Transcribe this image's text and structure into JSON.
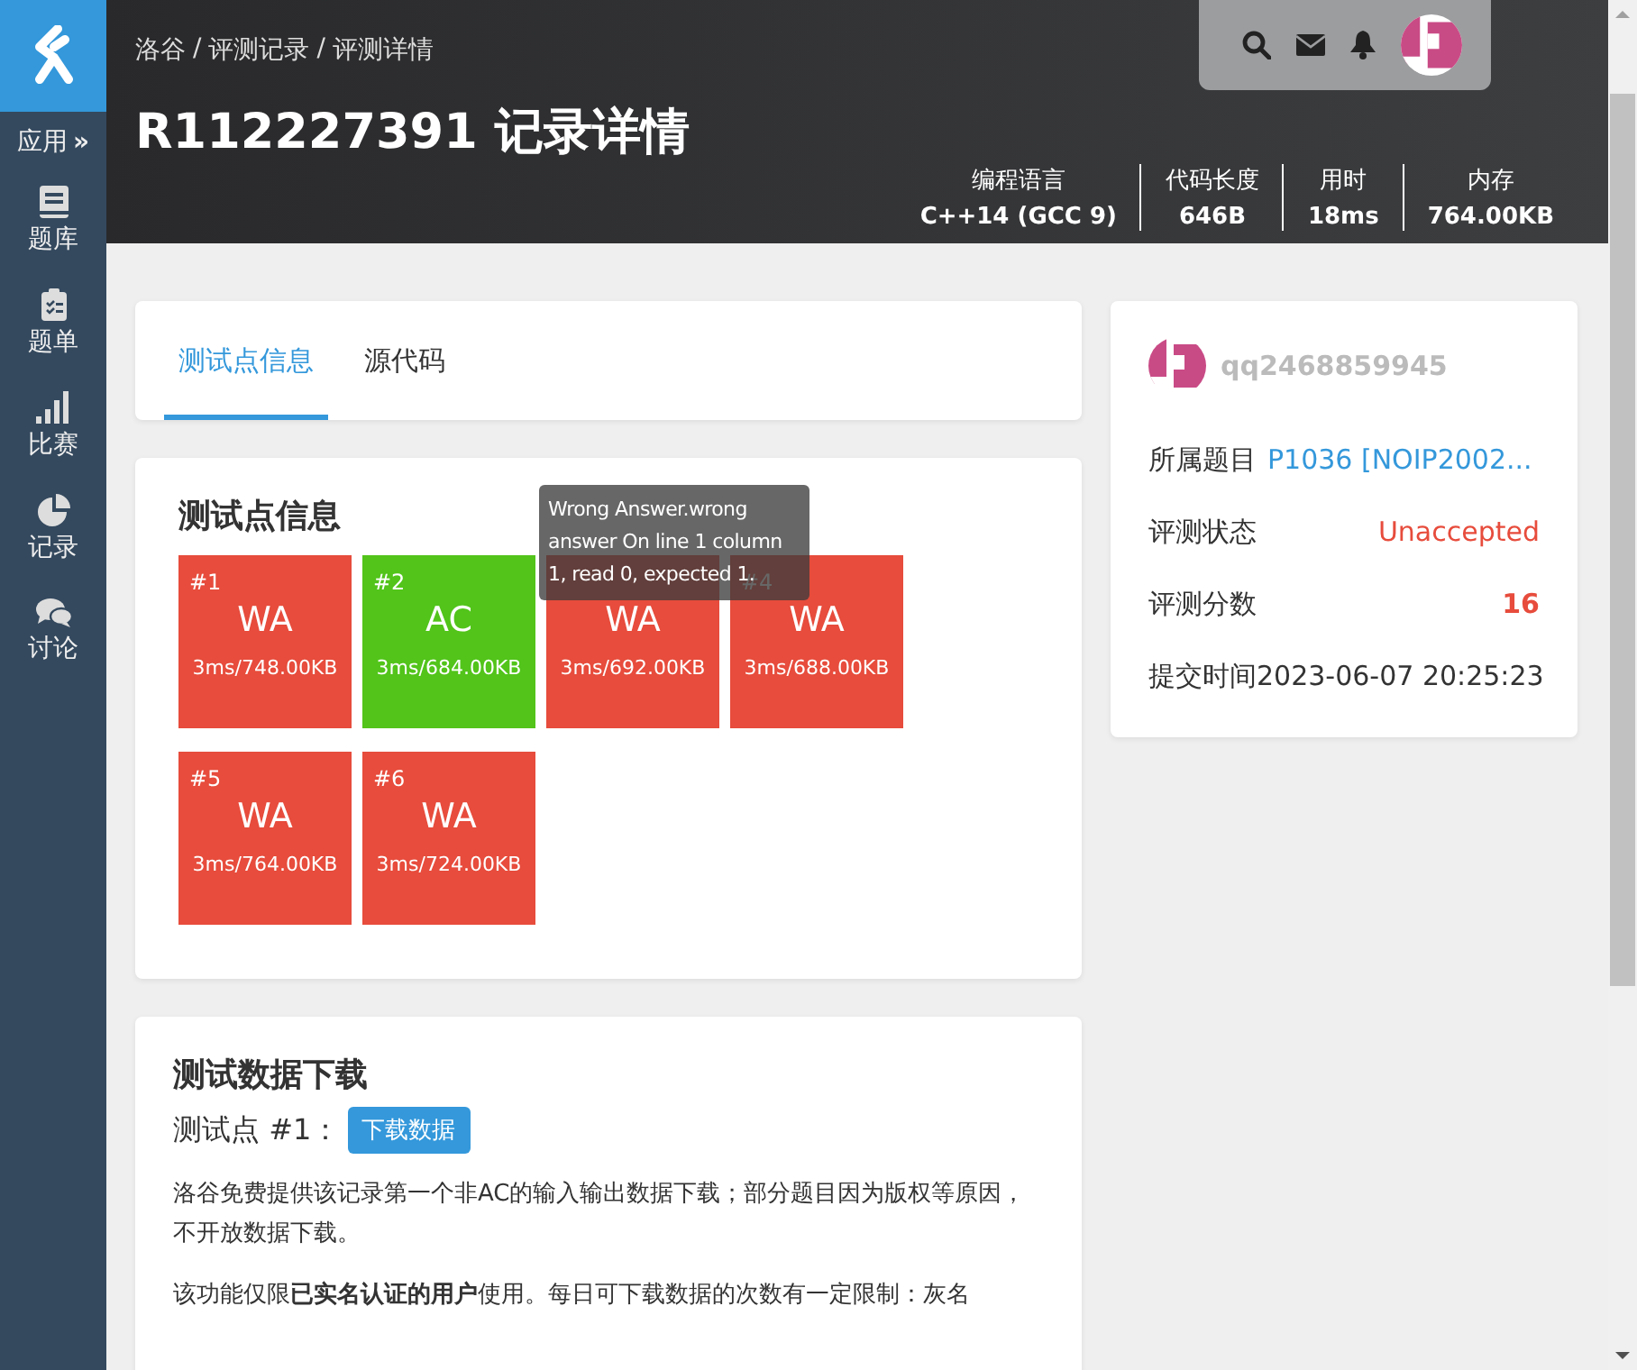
{
  "sidebar": {
    "apps_label": "应用",
    "apps_arrow": "»",
    "items": [
      {
        "kind": "book",
        "label": "题库"
      },
      {
        "kind": "clipboard",
        "label": "题单"
      },
      {
        "kind": "bars",
        "label": "比赛"
      },
      {
        "kind": "pie",
        "label": "记录"
      },
      {
        "kind": "chat",
        "label": "讨论"
      }
    ]
  },
  "header": {
    "breadcrumb": [
      "洛谷",
      "评测记录",
      "评测详情"
    ],
    "separator": "/",
    "title": "R112227391 记录详情",
    "stats": [
      {
        "label": "编程语言",
        "value": "C++14 (GCC 9)"
      },
      {
        "label": "代码长度",
        "value": "646B"
      },
      {
        "label": "用时",
        "value": "18ms"
      },
      {
        "label": "内存",
        "value": "764.00KB"
      }
    ]
  },
  "tabs": [
    {
      "label": "测试点信息",
      "selected": true
    },
    {
      "label": "源代码",
      "selected": false
    }
  ],
  "testcases": {
    "title": "测试点信息",
    "cases": [
      {
        "label": "#1",
        "status": "WA",
        "detail": "3ms/748.00KB"
      },
      {
        "label": "#2",
        "status": "AC",
        "detail": "3ms/684.00KB"
      },
      {
        "status": "WA",
        "detail": "3ms/692.00KB"
      },
      {
        "label": "#4",
        "status": "WA",
        "detail": "3ms/688.00KB"
      },
      {
        "label": "#5",
        "status": "WA",
        "detail": "3ms/764.00KB"
      },
      {
        "label": "#6",
        "status": "WA",
        "detail": "3ms/724.00KB"
      }
    ],
    "tooltip": "Wrong Answer.wrong answer On line 1 column 1, read 0, expected 1."
  },
  "download": {
    "title": "测试数据下载",
    "case_label": "测试点 #1：",
    "button": "下载数据",
    "paragraphs": [
      "洛谷免费提供该记录第一个非AC的输入输出数据下载；部分题目因为版权等原因，不开放数据下载。",
      "该功能仅限**已实名认证的用户**使用。每日可下载数据的次数有一定限制：灰名"
    ]
  },
  "info": {
    "username": "qq2468859945",
    "rows": [
      {
        "kind": "link",
        "label": "所属题目",
        "value": "P1036 [NOIP2002..."
      },
      {
        "kind": "status",
        "label": "评测状态",
        "value": "Unaccepted"
      },
      {
        "kind": "score",
        "label": "评测分数",
        "value": "16"
      },
      {
        "kind": "plain",
        "label": "提交时间",
        "value": "2023-06-07 20:25:23"
      }
    ]
  }
}
